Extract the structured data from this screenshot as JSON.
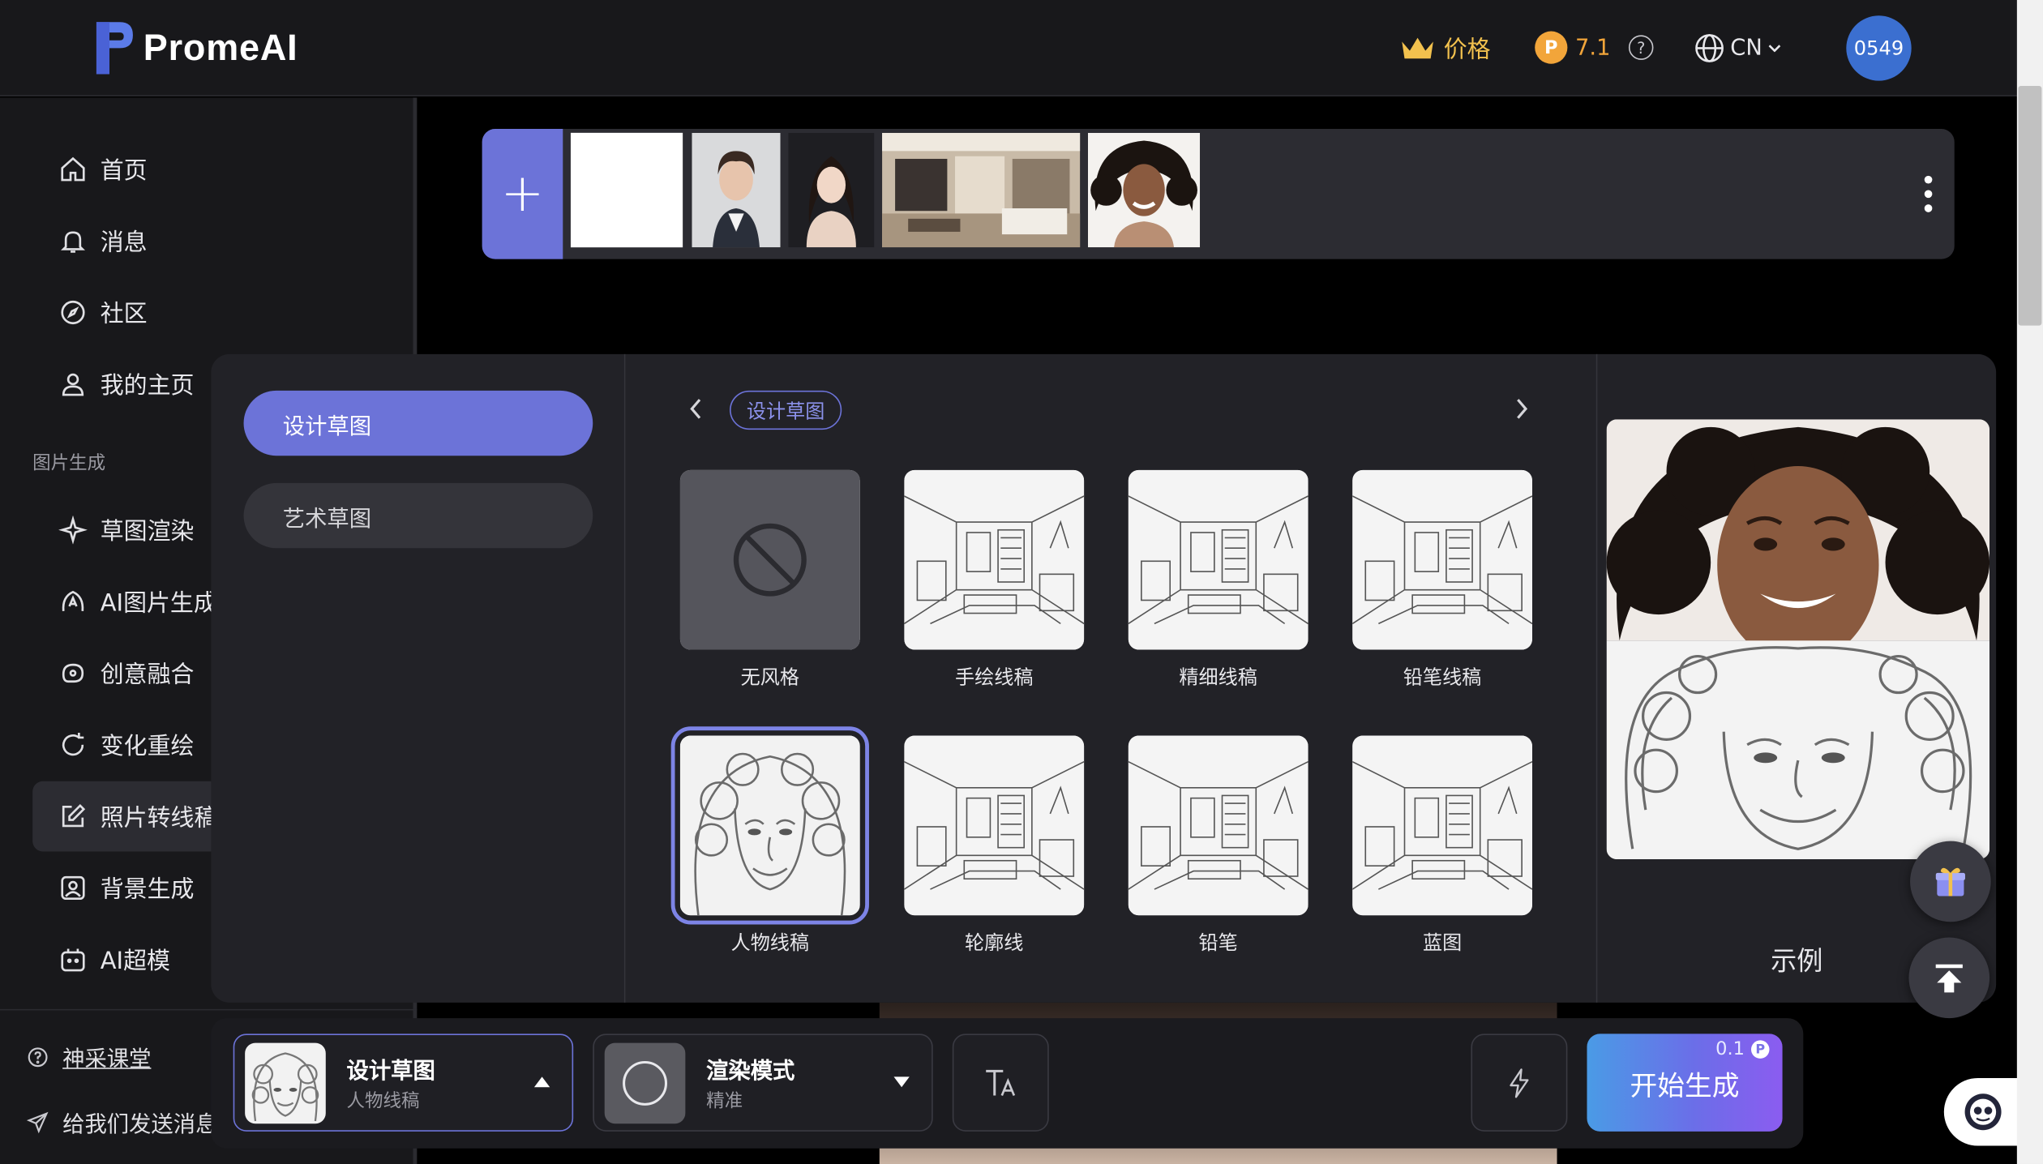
{
  "header": {
    "logo_text": "PromeAI",
    "pricing_label": "价格",
    "credits_value": "7.1",
    "language": "CN",
    "avatar_text": "0549"
  },
  "sidebar": {
    "items": [
      {
        "label": "首页",
        "icon": "home-icon"
      },
      {
        "label": "消息",
        "icon": "bell-icon"
      },
      {
        "label": "社区",
        "icon": "compass-icon"
      },
      {
        "label": "我的主页",
        "icon": "user-icon"
      }
    ],
    "section_title": "图片生成",
    "tools": [
      {
        "label": "草图渲染",
        "icon": "sparkle-icon"
      },
      {
        "label": "AI图片生成",
        "icon": "ai-image-icon"
      },
      {
        "label": "创意融合",
        "icon": "blend-icon"
      },
      {
        "label": "变化重绘",
        "icon": "refresh-icon"
      },
      {
        "label": "照片转线稿",
        "icon": "edit-icon",
        "active": true
      },
      {
        "label": "背景生成",
        "icon": "image-icon"
      },
      {
        "label": "AI超模",
        "icon": "robot-icon"
      }
    ],
    "footer": [
      {
        "label": "神采课堂",
        "icon": "help-icon"
      },
      {
        "label": "给我们发送消息",
        "icon": "send-icon"
      }
    ]
  },
  "style_panel": {
    "categories": [
      {
        "label": "设计草图",
        "selected": true
      },
      {
        "label": "艺术草图",
        "selected": false
      }
    ],
    "current_tag": "设计草图",
    "styles": [
      {
        "label": "无风格",
        "kind": "none"
      },
      {
        "label": "手绘线稿",
        "kind": "room"
      },
      {
        "label": "精细线稿",
        "kind": "room"
      },
      {
        "label": "铅笔线稿",
        "kind": "room"
      },
      {
        "label": "人物线稿",
        "kind": "portrait",
        "selected": true
      },
      {
        "label": "轮廓线",
        "kind": "room"
      },
      {
        "label": "铅笔",
        "kind": "room"
      },
      {
        "label": "蓝图",
        "kind": "room"
      }
    ],
    "example_label": "示例"
  },
  "toolbar": {
    "style_title": "设计草图",
    "style_sub": "人物线稿",
    "mode_title": "渲染模式",
    "mode_sub": "精准",
    "start_label": "开始生成",
    "cost": "0.1"
  },
  "colors": {
    "accent": "#6c73d8",
    "gold": "#f2c14e",
    "coin": "#f2a53a",
    "avatar": "#3b6fd0"
  }
}
